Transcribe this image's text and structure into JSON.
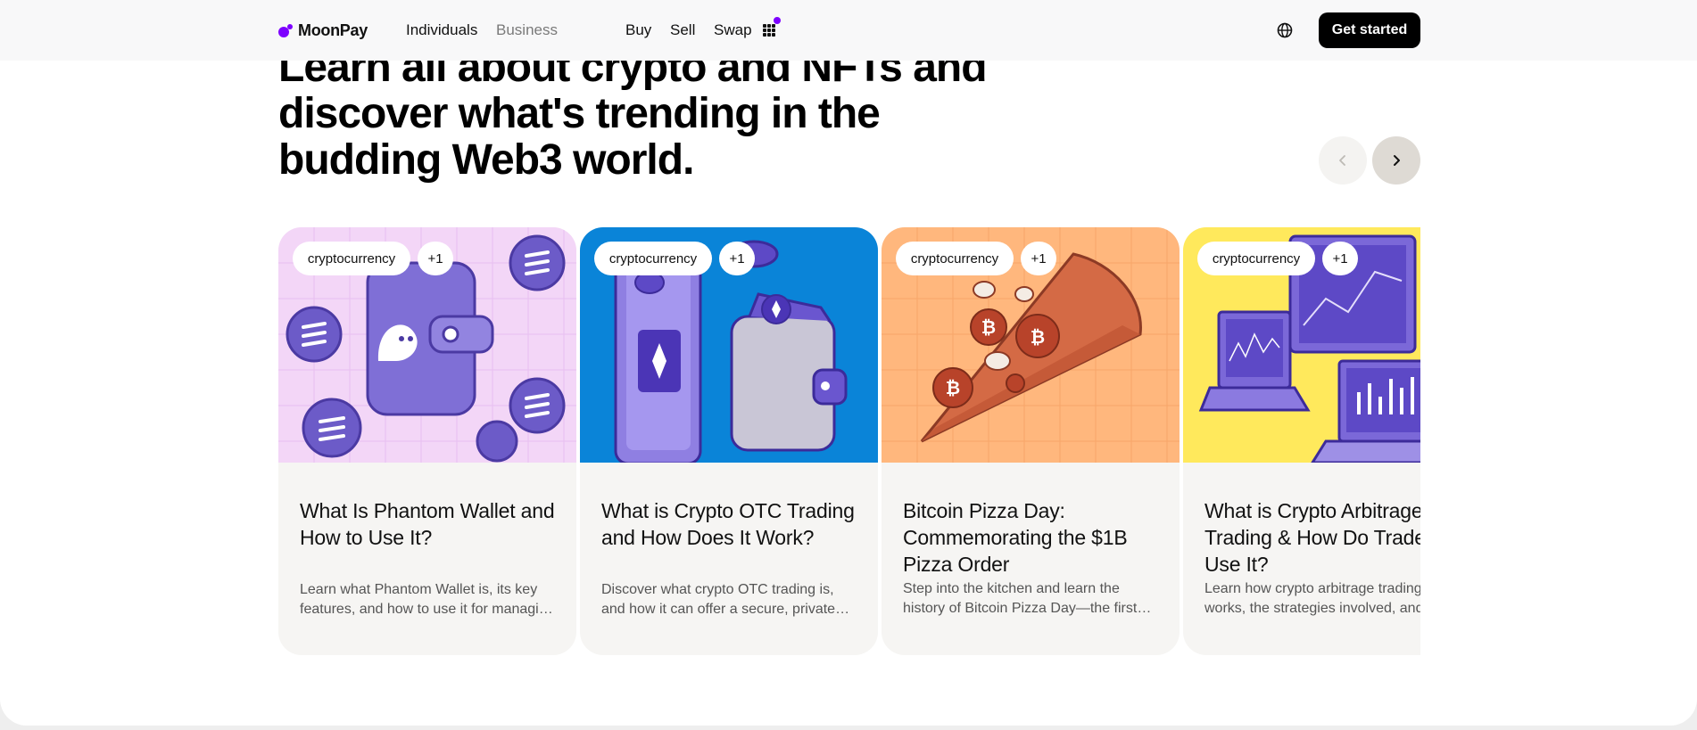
{
  "header": {
    "logo_text": "MoonPay",
    "nav_primary": [
      "Individuals",
      "Business"
    ],
    "nav_actions": [
      "Buy",
      "Sell",
      "Swap"
    ],
    "cta_label": "Get started"
  },
  "hero": {
    "headline": "Learn all about crypto and NFTs and discover what's trending in the budding Web3 world."
  },
  "cards": [
    {
      "tag": "cryptocurrency",
      "extra_tags": "+1",
      "title": "What Is Phantom Wallet and How to Use It?",
      "description": "Learn what Phantom Wallet is, its key features, and how to use it for managing your crypto.",
      "image_bg": "#f3d6f7"
    },
    {
      "tag": "cryptocurrency",
      "extra_tags": "+1",
      "title": "What is Crypto OTC Trading and How Does It Work?",
      "description": "Discover what crypto OTC trading is, and how it can offer a secure, private way to trade.",
      "image_bg": "#0a84d8"
    },
    {
      "tag": "cryptocurrency",
      "extra_tags": "+1",
      "title": "Bitcoin Pizza Day: Commemorating the $1B Pizza Order",
      "description": "Step into the kitchen and learn the history of Bitcoin Pizza Day—the first real-world purchase.",
      "image_bg": "#ffb77d"
    },
    {
      "tag": "cryptocurrency",
      "extra_tags": "+1",
      "title": "What is Crypto Arbitrage Trading & How Do Traders Use It?",
      "description": "Learn how crypto arbitrage trading works, the strategies involved, and the risks.",
      "image_bg": "#ffe95c"
    }
  ],
  "colors": {
    "brand_purple": "#7d00ff",
    "header_bg": "#f8f8f9",
    "card_bg": "#f6f5f3"
  }
}
